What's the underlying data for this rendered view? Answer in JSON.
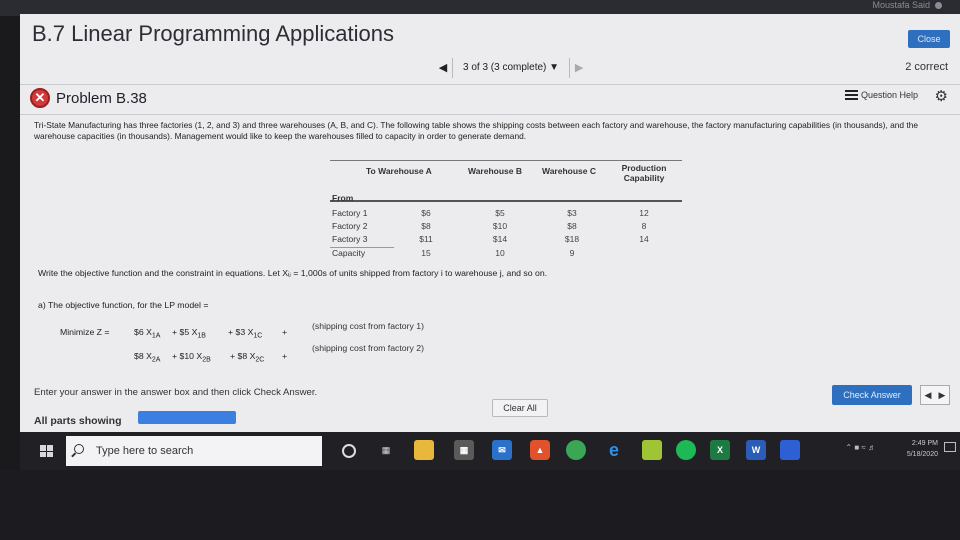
{
  "window": {
    "user_name": "Moustafa Said",
    "title": "B.7 Linear Programming Applications",
    "close_label": "Close"
  },
  "nav": {
    "prev_icon": "chevron-left",
    "position_label": "3 of 3 (3 complete) ▼",
    "next_icon": "chevron-right",
    "score_label": "2 correct"
  },
  "problem": {
    "label": "Problem B.38",
    "status_icon": "x-mark-icon",
    "help_label": "Question Help",
    "intro_text": "Tri-State Manufacturing has three factories (1, 2, and 3) and three warehouses (A, B, and C). The following table shows the shipping costs between each factory and warehouse, the factory manufacturing capabilities (in thousands), and the warehouse capacities (in thousands). Management would like to keep the warehouses filled to capacity in order to generate demand."
  },
  "table": {
    "headers": [
      "To Warehouse A",
      "Warehouse B",
      "Warehouse C",
      "Production Capability"
    ],
    "from_label": "From",
    "rows": [
      {
        "label": "Factory 1",
        "a": "$6",
        "b": "$5",
        "c": "$3",
        "cap": "12"
      },
      {
        "label": "Factory 2",
        "a": "$8",
        "b": "$10",
        "c": "$8",
        "cap": "8"
      },
      {
        "label": "Factory 3",
        "a": "$11",
        "b": "$14",
        "c": "$18",
        "cap": "14"
      },
      {
        "label": "Capacity",
        "a": "15",
        "b": "10",
        "c": "9",
        "cap": ""
      }
    ]
  },
  "work": {
    "instruction": "Write the objective function and the constraint in equations. Let Xᵢⱼ = 1,000s of units shipped from factory i to warehouse j, and so on.",
    "part_a": "a) The objective function, for the LP model =",
    "minimize_label": "Minimize Z =",
    "row1": {
      "t1": "$6 X",
      "s1": "1A",
      "t2": "+ $5 X",
      "s2": "1B",
      "t3": "+ $3 X",
      "s3": "1C",
      "plus": "+",
      "note": "(shipping cost from factory 1)"
    },
    "row2": {
      "t1": "$8 X",
      "s1": "2A",
      "t2": "+ $10 X",
      "s2": "2B",
      "t3": "+ $8 X",
      "s3": "2C",
      "plus": "+",
      "note": "(shipping cost from factory 2)"
    }
  },
  "footer": {
    "enter_text": "Enter your answer in the answer box and then click Check Answer.",
    "all_parts_label": "All parts showing",
    "all_parts_progress": 1.0,
    "clear_label": "Clear All",
    "check_label": "Check Answer"
  },
  "taskbar": {
    "search_placeholder": "Type here to search",
    "time": "2:49 PM",
    "date": "5/18/2020",
    "icons": [
      "cortana-circle-icon",
      "task-view-icon",
      "file-explorer-icon",
      "calculator-icon",
      "mail-icon",
      "brave-icon",
      "chrome-icon",
      "edge-icon",
      "game-icon",
      "spotify-icon",
      "excel-icon",
      "word-icon",
      "video-icon"
    ]
  }
}
